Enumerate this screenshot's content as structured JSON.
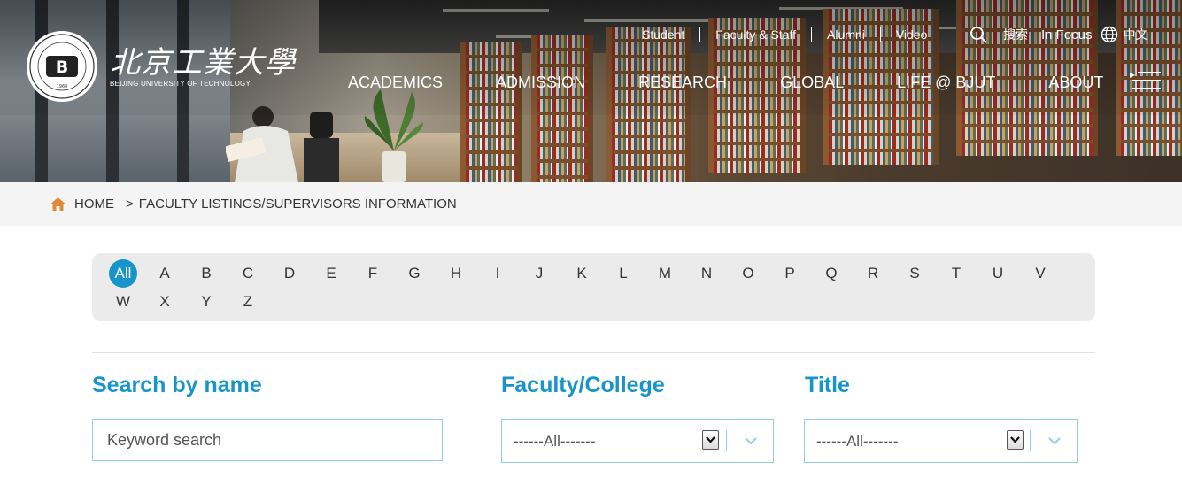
{
  "logo": {
    "chinese_name": "北京工業大學",
    "english_name": "BEIJING UNIVERSITY OF TECHNOLOGY",
    "seal_letter": "B",
    "seal_year": "1960"
  },
  "top_nav": {
    "links": [
      "Student",
      "Faculty & Staff",
      "Alumni",
      "Video"
    ],
    "search_label": "搜索",
    "in_focus": "In Focus",
    "language": "中文"
  },
  "main_nav": [
    "ACADEMICS",
    "ADMISSION",
    "RESEARCH",
    "GLOBAL",
    "LIFE @ BJUT",
    "ABOUT"
  ],
  "breadcrumb": {
    "home": "HOME",
    "separator": ">",
    "current": "FACULTY LISTINGS/SUPERVISORS INFORMATION"
  },
  "alphabet": {
    "active": "All",
    "letters": [
      "All",
      "A",
      "B",
      "C",
      "D",
      "E",
      "F",
      "G",
      "H",
      "I",
      "J",
      "K",
      "L",
      "M",
      "N",
      "O",
      "P",
      "Q",
      "R",
      "S",
      "T",
      "U",
      "V",
      "W",
      "X",
      "Y",
      "Z"
    ]
  },
  "search": {
    "name_label": "Search by name",
    "name_placeholder": "Keyword search",
    "faculty_label": "Faculty/College",
    "faculty_value": "------All-------",
    "title_label": "Title",
    "title_value": "------All-------"
  },
  "colors": {
    "accent": "#1794c9",
    "border": "#8fd0e2",
    "home_icon": "#e08b3a",
    "crumb_bg": "#f4f4f4",
    "alpha_bg": "#ebebeb"
  },
  "icons": [
    "search-icon",
    "globe-icon",
    "menu-icon",
    "home-icon",
    "chevron-down-icon"
  ]
}
